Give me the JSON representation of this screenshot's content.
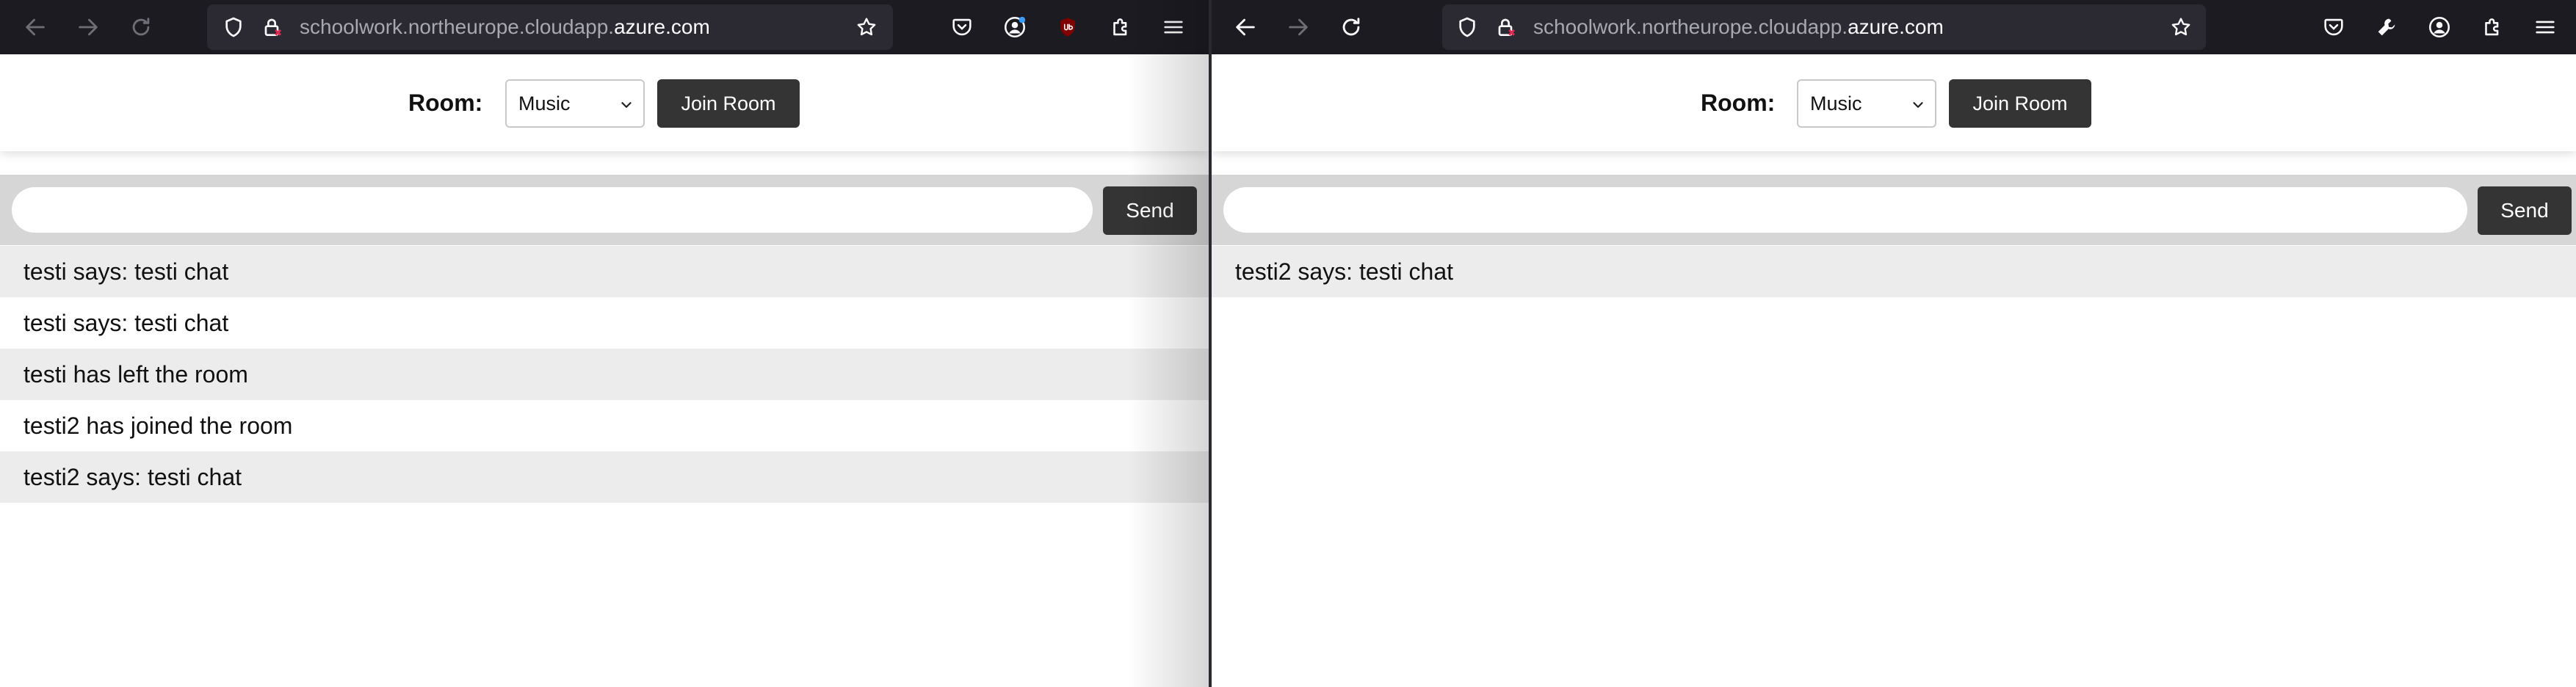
{
  "icons": {
    "back": "arrow-left-icon",
    "forward": "arrow-right-icon",
    "reload": "reload-icon",
    "shield": "shield-icon",
    "lock": "lock-icon",
    "bookmark": "star-icon",
    "pocket": "pocket-icon",
    "account": "account-icon",
    "extensions": "puzzle-icon",
    "menu": "hamburger-menu-icon",
    "tools": "wrench-icon"
  },
  "colors": {
    "toolbar_bg": "#1c1b22",
    "urlbar_bg": "#2b2a33",
    "button_bg": "#343434",
    "odd_row": "#ececec",
    "input_bar_bg": "#d6d6d6"
  },
  "left_window": {
    "url": {
      "prefix": "schoolwork.northeurope.cloudapp.",
      "domain": "azure.com"
    },
    "room_label": "Room:",
    "room_selected": "Music",
    "join_button": "Join Room",
    "send_button": "Send",
    "message_input_value": "",
    "messages": [
      "testi says: testi chat",
      "testi says: testi chat",
      "testi has left the room",
      "testi2 has joined the room",
      "testi2 says: testi chat"
    ]
  },
  "right_window": {
    "url": {
      "prefix": "schoolwork.northeurope.cloudapp.",
      "domain": "azure.com"
    },
    "room_label": "Room:",
    "room_selected": "Music",
    "join_button": "Join Room",
    "send_button": "Send",
    "message_input_value": "",
    "messages": [
      "testi2 says: testi chat"
    ]
  }
}
